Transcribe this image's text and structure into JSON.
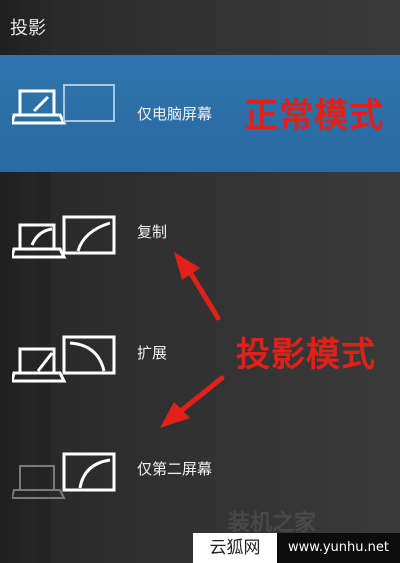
{
  "panel": {
    "title": "投影",
    "items": [
      {
        "label": "仅电脑屏幕",
        "icon": "pc-screen-only-icon",
        "selected": true
      },
      {
        "label": "复制",
        "icon": "duplicate-icon",
        "selected": false
      },
      {
        "label": "扩展",
        "icon": "extend-icon",
        "selected": false
      },
      {
        "label": "仅第二屏幕",
        "icon": "second-screen-only-icon",
        "selected": false
      }
    ]
  },
  "annotations": {
    "normal_mode": "正常模式",
    "projection_mode": "投影模式"
  },
  "watermark": {
    "text": "装机之家"
  },
  "footer": {
    "brand": "云狐网",
    "site": "www.yunhu.net"
  },
  "colors": {
    "selected_bg": "#2b6ea6",
    "annotation_red": "#e2201a",
    "panel_bg": "#343434"
  }
}
